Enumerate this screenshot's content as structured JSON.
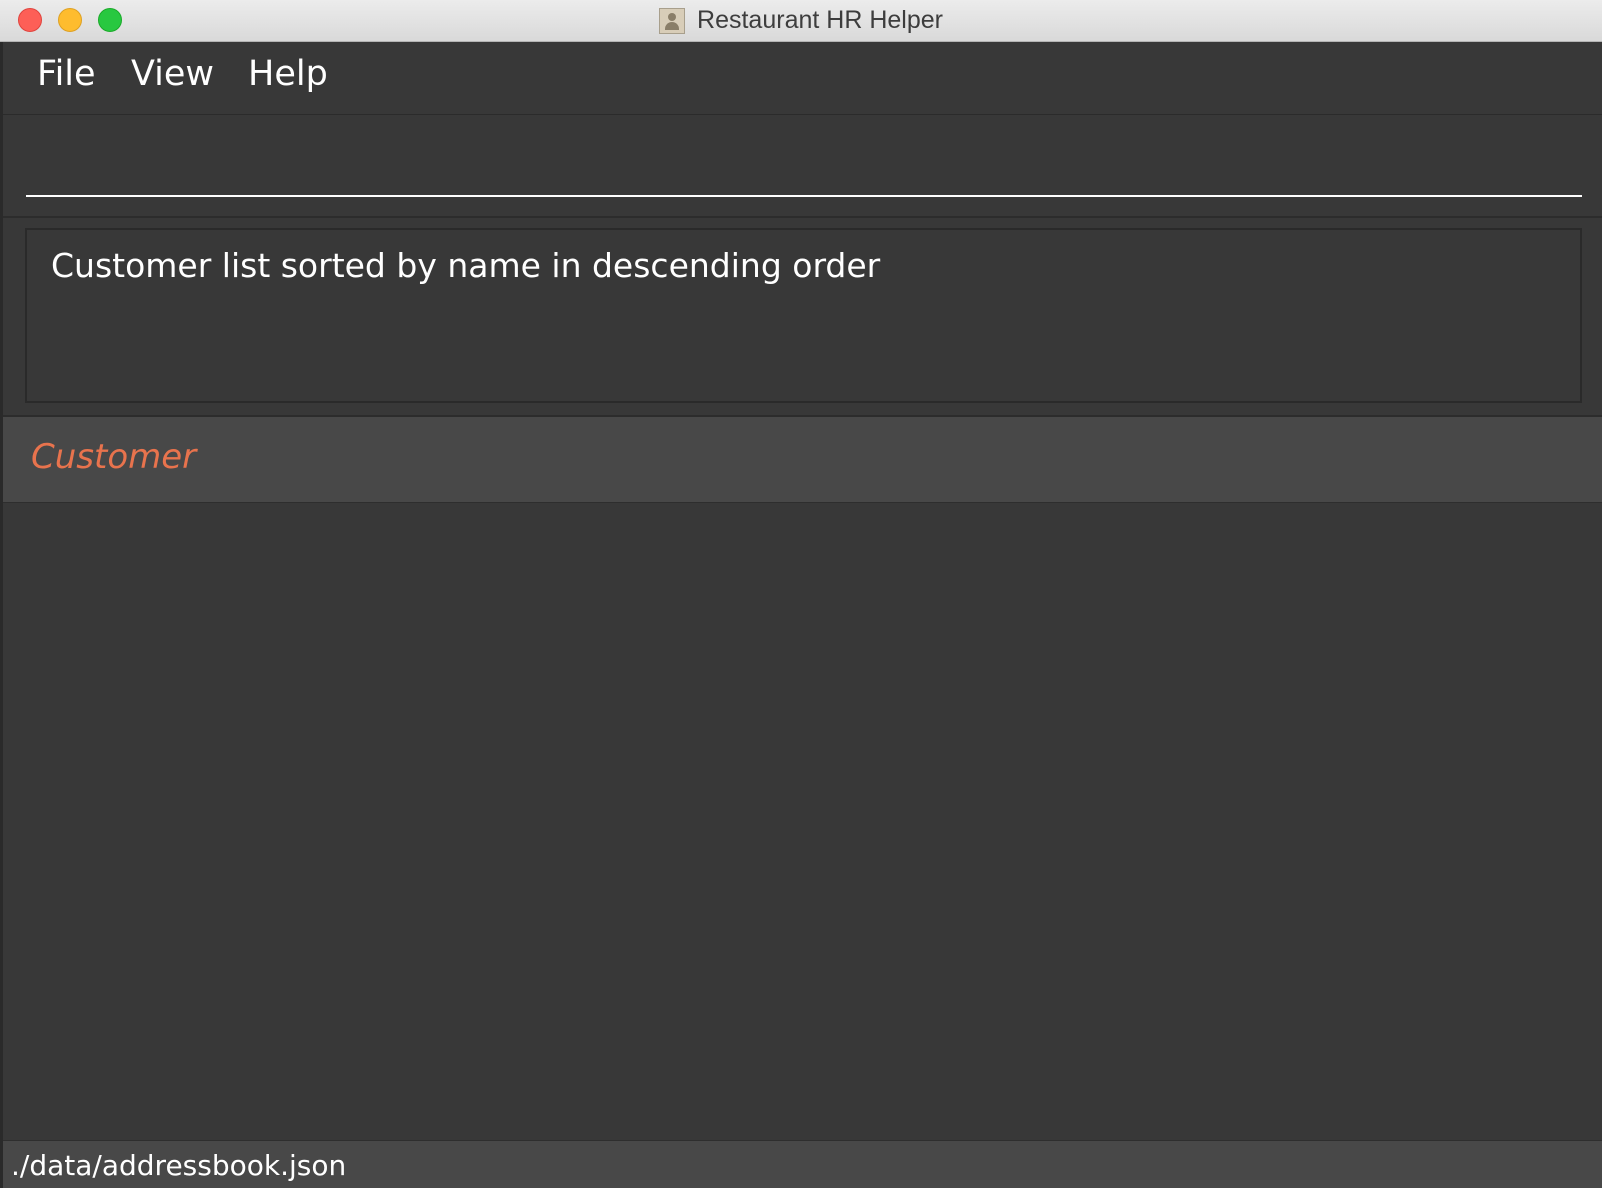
{
  "window": {
    "title": "Restaurant HR Helper",
    "app_icon": "address-book-icon",
    "controls": [
      "close",
      "minimize",
      "maximize"
    ]
  },
  "menu": {
    "items": [
      {
        "label": "File"
      },
      {
        "label": "View"
      },
      {
        "label": "Help"
      }
    ]
  },
  "command_box": {
    "value": "",
    "placeholder": ""
  },
  "result_display": {
    "text": "Customer list sorted by name in descending order"
  },
  "list_panel": {
    "title": "Customer",
    "title_color": "#e8734d",
    "items": []
  },
  "status_bar": {
    "file_path": "./data/addressbook.json"
  },
  "colors": {
    "background": "#383838",
    "panel_header": "#484848",
    "accent": "#e8734d",
    "text": "#ffffff"
  }
}
